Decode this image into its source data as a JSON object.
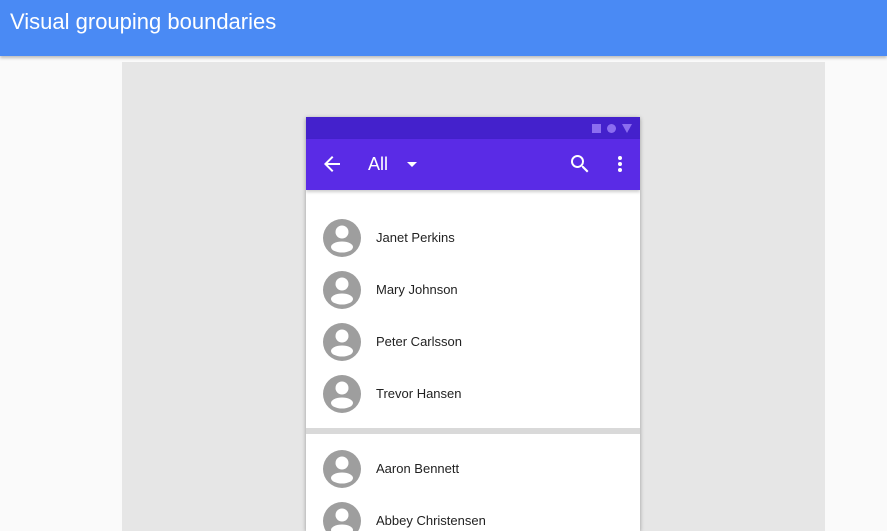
{
  "page": {
    "title": "Visual grouping boundaries"
  },
  "appbar": {
    "filter_label": "All"
  },
  "contacts": {
    "group_a": [
      {
        "name": "Janet Perkins"
      },
      {
        "name": "Mary Johnson"
      },
      {
        "name": "Peter Carlsson"
      },
      {
        "name": "Trevor Hansen"
      }
    ],
    "group_b": [
      {
        "name": "Aaron Bennett"
      },
      {
        "name": "Abbey Christensen"
      }
    ]
  },
  "icons": {
    "status": [
      "square-icon",
      "circle-icon",
      "triangle-icon"
    ],
    "appbar": [
      "arrow-back-icon",
      "arrow-drop-down-icon",
      "search-icon",
      "more-vert-icon"
    ],
    "avatar": "account-circle-icon"
  },
  "colors": {
    "topbar": "#4a8af4",
    "statusbar": "#4421cc",
    "appbar": "#5a2be6",
    "avatar": "#9e9e9e"
  }
}
